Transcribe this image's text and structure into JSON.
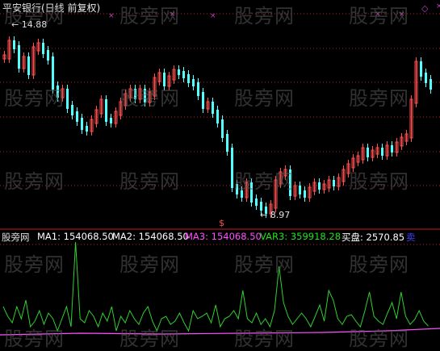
{
  "header": {
    "title": "平安银行(日线 前复权)"
  },
  "annotations": {
    "high_label": "14.88",
    "low_label": "8.97"
  },
  "indicator": {
    "name": "股旁网",
    "ma1": "MA1: 154068.50",
    "ma2": "MA2: 154068.50",
    "ma3": "MA3: 154068.50",
    "var3": "VAR3: 359918.28",
    "buy": "买盘: 2570.85",
    "sell": "卖"
  },
  "watermark": "股旁网",
  "colors": {
    "up": "#ff5050",
    "down": "#54ffff",
    "grid": "#b02020",
    "ma1": "#ffffff",
    "ma2": "#ffffff",
    "ma3": "#ff50ff",
    "var3": "#20e020",
    "buy": "#ffffff",
    "sell": "#4040ff",
    "marker": "#c040c0"
  }
}
